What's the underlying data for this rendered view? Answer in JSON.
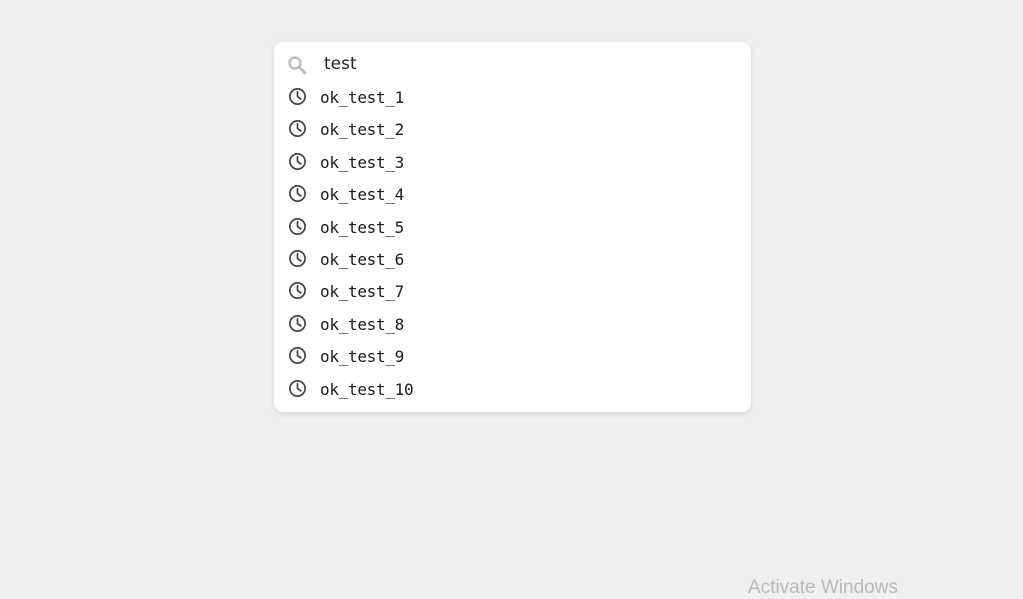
{
  "search": {
    "query": "test",
    "icon": "search-icon"
  },
  "suggestions": [
    {
      "label": "ok_test_1",
      "icon": "clock-icon"
    },
    {
      "label": "ok_test_2",
      "icon": "clock-icon"
    },
    {
      "label": "ok_test_3",
      "icon": "clock-icon"
    },
    {
      "label": "ok_test_4",
      "icon": "clock-icon"
    },
    {
      "label": "ok_test_5",
      "icon": "clock-icon"
    },
    {
      "label": "ok_test_6",
      "icon": "clock-icon"
    },
    {
      "label": "ok_test_7",
      "icon": "clock-icon"
    },
    {
      "label": "ok_test_8",
      "icon": "clock-icon"
    },
    {
      "label": "ok_test_9",
      "icon": "clock-icon"
    },
    {
      "label": "ok_test_10",
      "icon": "clock-icon"
    }
  ],
  "watermark": {
    "text": "Activate Windows"
  },
  "colors": {
    "background": "#efefef",
    "panel": "#ffffff",
    "text": "#1a1a1a",
    "icon": "#444444",
    "search_icon": "#bdbdbd",
    "watermark": "#b9b9b9"
  }
}
